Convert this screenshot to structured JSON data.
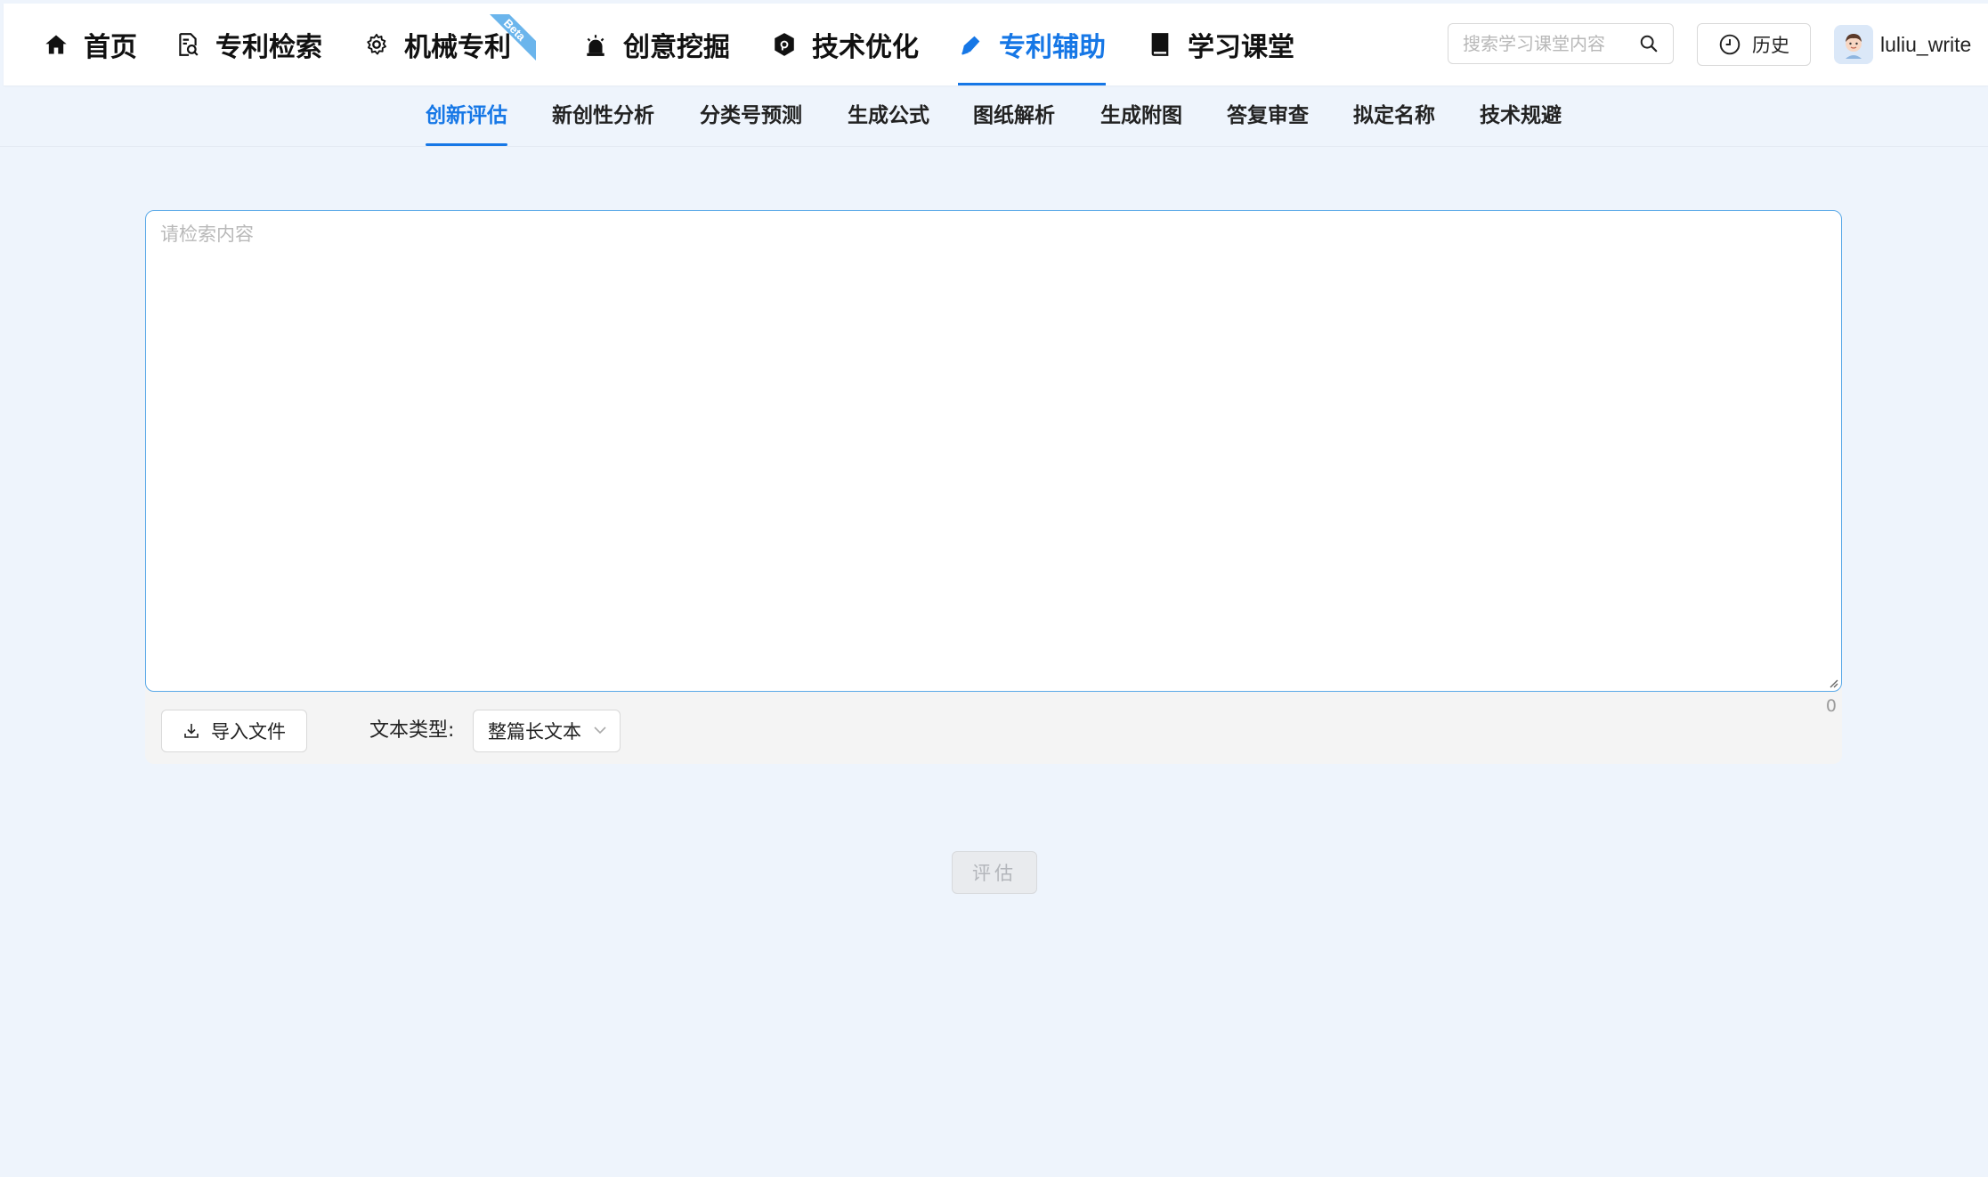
{
  "nav": {
    "items": [
      {
        "label": "首页",
        "icon": "home-icon"
      },
      {
        "label": "专利检索",
        "icon": "patent-search-icon"
      },
      {
        "label": "机械专利",
        "icon": "gear-icon",
        "badge": "Beta"
      },
      {
        "label": "创意挖掘",
        "icon": "alarm-icon"
      },
      {
        "label": "技术优化",
        "icon": "hex-badge-icon"
      },
      {
        "label": "专利辅助",
        "icon": "pen-icon",
        "active": true
      },
      {
        "label": "学习课堂",
        "icon": "book-icon"
      }
    ],
    "badge_text": "Beta",
    "search_placeholder": "搜索学习课堂内容",
    "history_label": "历史",
    "username": "luliu_write"
  },
  "subtabs": {
    "items": [
      "创新评估",
      "新创性分析",
      "分类号预测",
      "生成公式",
      "图纸解析",
      "生成附图",
      "答复审查",
      "拟定名称",
      "技术规避"
    ],
    "active_index": 0
  },
  "editor": {
    "placeholder": "请检索内容",
    "value": "",
    "char_count": "0"
  },
  "toolbar": {
    "import_label": "导入文件",
    "text_type_label": "文本类型:",
    "text_type_value": "整篇长文本"
  },
  "action": {
    "evaluate_label": "评估",
    "disabled": true
  },
  "colors": {
    "accent": "#1677e6",
    "background": "#eef4fc",
    "border_focus": "#5aa9e8",
    "badge": "#6bb5ec"
  }
}
